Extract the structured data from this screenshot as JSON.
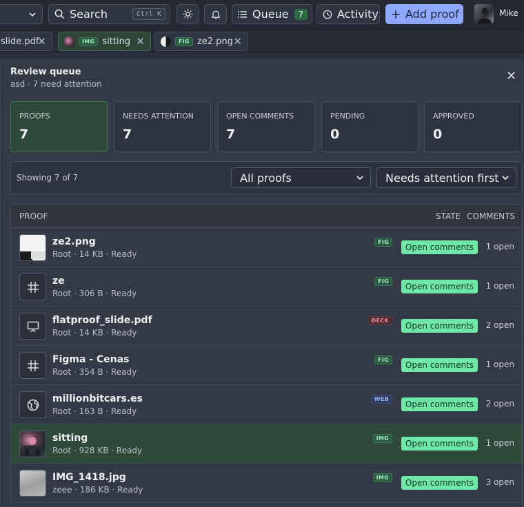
{
  "toolbar": {
    "search_label": "Search",
    "search_shortcut": "Ctrl K",
    "queue_label": "Queue",
    "queue_count": "7",
    "activity_label": "Activity",
    "add_proof_label": "Add proof",
    "user_name": "Mike"
  },
  "tabs": [
    {
      "label": "slide.pdf",
      "type": ""
    },
    {
      "label": "sitting",
      "type": "IMG"
    },
    {
      "label": "ze2.png",
      "type": "FIG"
    }
  ],
  "panel": {
    "title": "Review queue",
    "subtitle": "asd · 7 need attention",
    "stats": [
      {
        "label": "PROOFS",
        "value": "7"
      },
      {
        "label": "NEEDS ATTENTION",
        "value": "7"
      },
      {
        "label": "OPEN COMMENTS",
        "value": "7"
      },
      {
        "label": "PENDING",
        "value": "0"
      },
      {
        "label": "APPROVED",
        "value": "0"
      }
    ],
    "showing": "Showing 7 of 7",
    "filter_value": "All proofs",
    "sort_value": "Needs attention first",
    "columns": {
      "proof": "PROOF",
      "state": "STATE",
      "comments": "COMMENTS"
    },
    "rows": [
      {
        "name": "ze2.png",
        "meta": "Root · 14 KB · Ready",
        "type": "FIG",
        "state": "Open comments",
        "comments": "1 open",
        "icon": "image-thumbnail"
      },
      {
        "name": "ze",
        "meta": "Root · 306 B · Ready",
        "type": "FIG",
        "state": "Open comments",
        "comments": "1 open",
        "icon": "grid-hash-icon"
      },
      {
        "name": "flatproof_slide.pdf",
        "meta": "Root · 14 KB · Ready",
        "type": "DECK",
        "state": "Open comments",
        "comments": "2 open",
        "icon": "presentation-icon"
      },
      {
        "name": "Figma - Cenas",
        "meta": "Root · 354 B · Ready",
        "type": "FIG",
        "state": "Open comments",
        "comments": "1 open",
        "icon": "grid-hash-icon"
      },
      {
        "name": "millionbitcars.es",
        "meta": "Root · 163 B · Ready",
        "type": "WEB",
        "state": "Open comments",
        "comments": "2 open",
        "icon": "globe-icon"
      },
      {
        "name": "sitting",
        "meta": "Root · 928 KB · Ready",
        "type": "IMG",
        "state": "Open comments",
        "comments": "1 open",
        "icon": "photo-thumbnail"
      },
      {
        "name": "IMG_1418.jpg",
        "meta": "zeee · 186 KB · Ready",
        "type": "IMG",
        "state": "Open comments",
        "comments": "3 open",
        "icon": "photo-thumbnail"
      }
    ]
  }
}
